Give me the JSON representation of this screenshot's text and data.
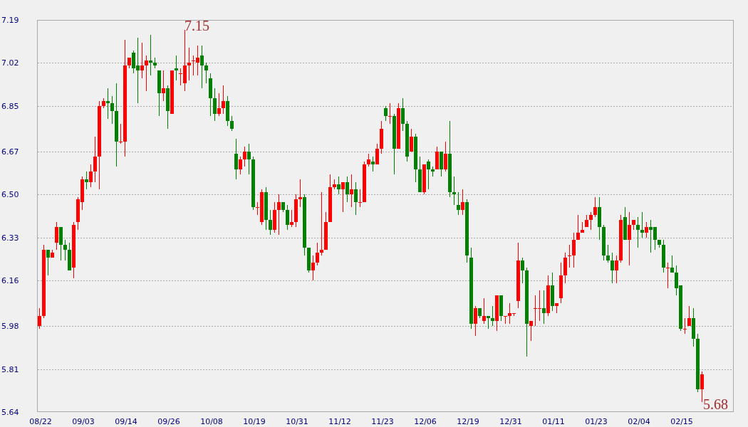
{
  "chart": {
    "chart_data": {
      "type": "candlestick",
      "ylim": [
        5.64,
        7.19
      ],
      "grid": true,
      "yticks": [
        {
          "value": 7.19,
          "label": "7.19"
        },
        {
          "value": 7.02,
          "label": "7.02"
        },
        {
          "value": 6.85,
          "label": "6.85"
        },
        {
          "value": 6.67,
          "label": "6.67"
        },
        {
          "value": 6.5,
          "label": "6.50"
        },
        {
          "value": 6.33,
          "label": "6.33"
        },
        {
          "value": 6.16,
          "label": "6.16"
        },
        {
          "value": 5.98,
          "label": "5.98"
        },
        {
          "value": 5.81,
          "label": "5.81"
        },
        {
          "value": 5.64,
          "label": "5.64"
        }
      ],
      "categories": [
        "08/22",
        null,
        null,
        null,
        null,
        null,
        null,
        null,
        null,
        null,
        "09/03",
        null,
        null,
        null,
        null,
        null,
        null,
        null,
        null,
        null,
        "09/14",
        null,
        null,
        null,
        null,
        null,
        null,
        null,
        null,
        null,
        "09/26",
        null,
        null,
        null,
        null,
        null,
        null,
        null,
        null,
        null,
        "10/08",
        null,
        null,
        null,
        null,
        null,
        null,
        null,
        null,
        null,
        "10/19",
        null,
        null,
        null,
        null,
        null,
        null,
        null,
        null,
        null,
        "10/31",
        null,
        null,
        null,
        null,
        null,
        null,
        null,
        null,
        null,
        "11/12",
        null,
        null,
        null,
        null,
        null,
        null,
        null,
        null,
        null,
        "11/23",
        null,
        null,
        null,
        null,
        null,
        null,
        null,
        null,
        null,
        "12/06",
        null,
        null,
        null,
        null,
        null,
        null,
        null,
        null,
        null,
        "12/19",
        null,
        null,
        null,
        null,
        null,
        null,
        null,
        null,
        null,
        "12/31",
        null,
        null,
        null,
        null,
        null,
        null,
        null,
        null,
        null,
        "01/11",
        null,
        null,
        null,
        null,
        null,
        null,
        null,
        null,
        null,
        "01/23",
        null,
        null,
        null,
        null,
        null,
        null,
        null,
        null,
        null,
        "02/04",
        null,
        null,
        null,
        null,
        null,
        null,
        null,
        null,
        null,
        "02/15",
        null,
        null,
        null,
        null,
        null
      ],
      "ohlc": [
        [
          5.98,
          6.05,
          5.97,
          6.02
        ],
        [
          6.02,
          6.3,
          6.01,
          6.28
        ],
        [
          6.28,
          6.28,
          6.18,
          6.25
        ],
        [
          6.25,
          6.28,
          6.25,
          6.27
        ],
        [
          6.31,
          6.39,
          6.28,
          6.37
        ],
        [
          6.37,
          6.37,
          6.24,
          6.3
        ],
        [
          6.3,
          6.32,
          6.24,
          6.28
        ],
        [
          6.28,
          6.31,
          6.2,
          6.2
        ],
        [
          6.21,
          6.39,
          6.17,
          6.38
        ],
        [
          6.39,
          6.49,
          6.36,
          6.48
        ],
        [
          6.47,
          6.57,
          6.44,
          6.56
        ],
        [
          6.56,
          6.59,
          6.52,
          6.55
        ],
        [
          6.55,
          6.62,
          6.53,
          6.59
        ],
        [
          6.59,
          6.73,
          6.55,
          6.65
        ],
        [
          6.65,
          6.87,
          6.52,
          6.85
        ],
        [
          6.85,
          6.88,
          6.84,
          6.87
        ],
        [
          6.87,
          6.92,
          6.8,
          6.86
        ],
        [
          6.86,
          6.89,
          6.78,
          6.83
        ],
        [
          6.83,
          6.94,
          6.61,
          6.71
        ],
        [
          6.71,
          6.78,
          6.7,
          6.71
        ],
        [
          6.71,
          7.11,
          6.65,
          7.01
        ],
        [
          7.01,
          7.04,
          7.0,
          7.04
        ],
        [
          7.06,
          7.07,
          6.98,
          7.0
        ],
        [
          7.01,
          7.12,
          6.86,
          6.99
        ],
        [
          6.99,
          7.1,
          6.96,
          7.01
        ],
        [
          7.01,
          7.05,
          6.91,
          7.03
        ],
        [
          7.03,
          7.13,
          6.97,
          7.02
        ],
        [
          7.02,
          7.04,
          7.0,
          7.01
        ],
        [
          6.99,
          6.99,
          6.81,
          6.9
        ],
        [
          6.9,
          6.99,
          6.87,
          6.92
        ],
        [
          6.92,
          6.93,
          6.76,
          6.83
        ],
        [
          6.82,
          6.99,
          6.82,
          6.99
        ],
        [
          7.0,
          7.05,
          6.95,
          6.99
        ],
        [
          6.98,
          7.0,
          6.93,
          6.98
        ],
        [
          6.94,
          7.15,
          6.91,
          7.01
        ],
        [
          7.01,
          7.08,
          6.95,
          7.02
        ],
        [
          7.03,
          7.05,
          6.97,
          7.03
        ],
        [
          7.02,
          7.09,
          6.97,
          7.04
        ],
        [
          7.05,
          7.09,
          6.92,
          7.01
        ],
        [
          7.01,
          7.02,
          6.94,
          6.99
        ],
        [
          6.96,
          6.98,
          6.81,
          6.88
        ],
        [
          6.88,
          6.92,
          6.79,
          6.82
        ],
        [
          6.82,
          6.9,
          6.81,
          6.84
        ],
        [
          6.84,
          6.93,
          6.82,
          6.87
        ],
        [
          6.87,
          6.89,
          6.77,
          6.79
        ],
        [
          6.79,
          6.81,
          6.75,
          6.76
        ],
        [
          6.66,
          6.72,
          6.56,
          6.6
        ],
        [
          6.6,
          6.65,
          6.58,
          6.64
        ],
        [
          6.64,
          6.69,
          6.61,
          6.67
        ],
        [
          6.67,
          6.7,
          6.58,
          6.64
        ],
        [
          6.64,
          6.65,
          6.44,
          6.45
        ],
        [
          6.45,
          6.47,
          6.42,
          6.45
        ],
        [
          6.39,
          6.52,
          6.38,
          6.51
        ],
        [
          6.51,
          6.53,
          6.36,
          6.4
        ],
        [
          6.4,
          6.44,
          6.34,
          6.36
        ],
        [
          6.36,
          6.47,
          6.35,
          6.44
        ],
        [
          6.44,
          6.5,
          6.34,
          6.47
        ],
        [
          6.47,
          6.47,
          6.43,
          6.44
        ],
        [
          6.44,
          6.46,
          6.36,
          6.38
        ],
        [
          6.38,
          6.44,
          6.37,
          6.39
        ],
        [
          6.39,
          6.5,
          6.37,
          6.48
        ],
        [
          6.48,
          6.56,
          6.45,
          6.49
        ],
        [
          6.49,
          6.5,
          6.26,
          6.29
        ],
        [
          6.29,
          6.29,
          6.19,
          6.2
        ],
        [
          6.2,
          6.26,
          6.16,
          6.23
        ],
        [
          6.23,
          6.31,
          6.22,
          6.27
        ],
        [
          6.27,
          6.51,
          6.26,
          6.28
        ],
        [
          6.28,
          6.43,
          6.28,
          6.39
        ],
        [
          6.39,
          6.58,
          6.39,
          6.53
        ],
        [
          6.53,
          6.56,
          6.52,
          6.54
        ],
        [
          6.54,
          6.57,
          6.5,
          6.52
        ],
        [
          6.52,
          6.55,
          6.43,
          6.55
        ],
        [
          6.55,
          6.57,
          6.47,
          6.5
        ],
        [
          6.5,
          6.58,
          6.45,
          6.52
        ],
        [
          6.52,
          6.55,
          6.42,
          6.47
        ],
        [
          6.47,
          6.52,
          6.45,
          6.47
        ],
        [
          6.47,
          6.63,
          6.47,
          6.62
        ],
        [
          6.62,
          6.66,
          6.61,
          6.64
        ],
        [
          6.63,
          6.65,
          6.59,
          6.62
        ],
        [
          6.62,
          6.7,
          6.62,
          6.68
        ],
        [
          6.68,
          6.79,
          6.66,
          6.76
        ],
        [
          6.84,
          6.85,
          6.79,
          6.81
        ],
        [
          6.81,
          6.86,
          6.78,
          6.81
        ],
        [
          6.81,
          6.82,
          6.58,
          6.68
        ],
        [
          6.68,
          6.86,
          6.68,
          6.84
        ],
        [
          6.84,
          6.88,
          6.75,
          6.78
        ],
        [
          6.78,
          6.79,
          6.63,
          6.65
        ],
        [
          6.67,
          6.76,
          6.67,
          6.73
        ],
        [
          6.73,
          6.74,
          6.55,
          6.6
        ],
        [
          6.6,
          6.65,
          6.51,
          6.51
        ],
        [
          6.51,
          6.62,
          6.5,
          6.62
        ],
        [
          6.63,
          6.64,
          6.52,
          6.6
        ],
        [
          6.6,
          6.61,
          6.57,
          6.59
        ],
        [
          6.6,
          6.69,
          6.6,
          6.67
        ],
        [
          6.67,
          6.67,
          6.57,
          6.6
        ],
        [
          6.6,
          6.71,
          6.59,
          6.66
        ],
        [
          6.66,
          6.79,
          6.49,
          6.51
        ],
        [
          6.51,
          6.57,
          6.46,
          6.5
        ],
        [
          6.46,
          6.51,
          6.42,
          6.44
        ],
        [
          6.44,
          6.52,
          6.42,
          6.47
        ],
        [
          6.47,
          6.48,
          6.23,
          6.26
        ],
        [
          6.25,
          6.29,
          5.97,
          5.99
        ],
        [
          5.99,
          6.06,
          5.94,
          6.05
        ],
        [
          6.05,
          6.05,
          6.01,
          6.02
        ],
        [
          6.0,
          6.09,
          5.99,
          6.02
        ],
        [
          6.02,
          6.02,
          5.97,
          6.01
        ],
        [
          6.01,
          6.06,
          5.98,
          6.0
        ],
        [
          6.0,
          6.1,
          5.96,
          6.1
        ],
        [
          6.1,
          6.1,
          6.0,
          6.02
        ],
        [
          6.02,
          6.02,
          5.99,
          6.02
        ],
        [
          6.02,
          6.07,
          5.99,
          6.03
        ],
        [
          6.03,
          6.03,
          6.02,
          6.03
        ],
        [
          6.08,
          6.31,
          6.05,
          6.24
        ],
        [
          6.24,
          6.25,
          6.15,
          6.2
        ],
        [
          6.2,
          6.21,
          5.86,
          5.99
        ],
        [
          5.98,
          6.0,
          5.92,
          6.0
        ],
        [
          6.05,
          6.1,
          5.98,
          6.05
        ],
        [
          6.05,
          6.12,
          6.0,
          6.05
        ],
        [
          6.05,
          6.12,
          5.99,
          6.03
        ],
        [
          6.03,
          6.18,
          6.02,
          6.14
        ],
        [
          6.14,
          6.19,
          6.04,
          6.06
        ],
        [
          6.06,
          6.07,
          6.03,
          6.07
        ],
        [
          6.09,
          6.23,
          6.07,
          6.18
        ],
        [
          6.18,
          6.27,
          6.15,
          6.25
        ],
        [
          6.26,
          6.3,
          6.21,
          6.26
        ],
        [
          6.26,
          6.35,
          6.21,
          6.32
        ],
        [
          6.32,
          6.42,
          6.32,
          6.35
        ],
        [
          6.35,
          6.39,
          6.35,
          6.36
        ],
        [
          6.37,
          6.42,
          6.37,
          6.4
        ],
        [
          6.4,
          6.43,
          6.36,
          6.42
        ],
        [
          6.42,
          6.49,
          6.41,
          6.45
        ],
        [
          6.45,
          6.49,
          6.32,
          6.37
        ],
        [
          6.37,
          6.38,
          6.24,
          6.26
        ],
        [
          6.26,
          6.3,
          6.23,
          6.24
        ],
        [
          6.24,
          6.27,
          6.15,
          6.2
        ],
        [
          6.2,
          6.26,
          6.15,
          6.24
        ],
        [
          6.24,
          6.42,
          6.23,
          6.4
        ],
        [
          6.41,
          6.45,
          6.32,
          6.32
        ],
        [
          6.32,
          6.43,
          6.22,
          6.38
        ],
        [
          6.38,
          6.4,
          6.36,
          6.4
        ],
        [
          6.38,
          6.41,
          6.29,
          6.36
        ],
        [
          6.36,
          6.43,
          6.33,
          6.35
        ],
        [
          6.35,
          6.39,
          6.33,
          6.37
        ],
        [
          6.37,
          6.4,
          6.27,
          6.36
        ],
        [
          6.37,
          6.37,
          6.28,
          6.32
        ],
        [
          6.32,
          6.32,
          6.29,
          6.3
        ],
        [
          6.3,
          6.32,
          6.19,
          6.21
        ],
        [
          6.21,
          6.23,
          6.13,
          6.21
        ],
        [
          6.21,
          6.26,
          6.19,
          6.19
        ],
        [
          6.19,
          6.22,
          6.1,
          6.13
        ],
        [
          6.14,
          6.14,
          5.96,
          5.97
        ],
        [
          5.97,
          6.01,
          5.95,
          5.97
        ],
        [
          5.98,
          6.06,
          5.98,
          6.01
        ],
        [
          6.01,
          6.05,
          5.9,
          5.93
        ],
        [
          5.93,
          5.95,
          5.72,
          5.73
        ],
        [
          5.73,
          5.8,
          5.68,
          5.79
        ]
      ],
      "annotations": [
        "7.15",
        "5.68"
      ]
    }
  }
}
